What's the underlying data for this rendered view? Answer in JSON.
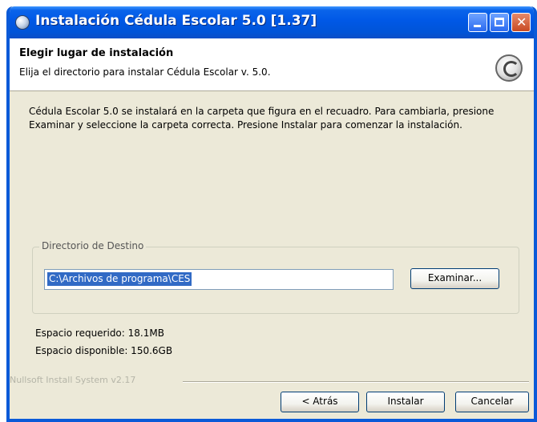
{
  "window": {
    "title": "Instalación Cédula Escolar 5.0 [1.37]"
  },
  "header": {
    "title": "Elegir lugar de instalación",
    "subtitle": "Elija el directorio para instalar Cédula Escolar v. 5.0."
  },
  "body": {
    "description": "Cédula Escolar 5.0 se instalará en la carpeta que figura en el recuadro. Para cambiarla, presione Examinar y seleccione la carpeta correcta. Presione Instalar para comenzar la instalación."
  },
  "destination": {
    "group_label": "Directorio de Destino",
    "path_value": "C:\\Archivos de programa\\CES",
    "browse_label": "Examinar..."
  },
  "space": {
    "required": "Espacio requerido: 18.1MB",
    "available": "Espacio disponible: 150.6GB"
  },
  "footer": {
    "brand": "Nullsoft Install System v2.17",
    "back_label": "< Atrás",
    "install_label": "Instalar",
    "cancel_label": "Cancelar"
  },
  "icons": {
    "title": "installer-icon",
    "header": "setup-logo-icon",
    "minimize": "minimize-icon",
    "maximize": "maximize-icon",
    "close": "close-icon"
  },
  "colors": {
    "titlebar": "#0058e6",
    "selection": "#316ac5",
    "dialog_bg": "#ece9d8"
  }
}
